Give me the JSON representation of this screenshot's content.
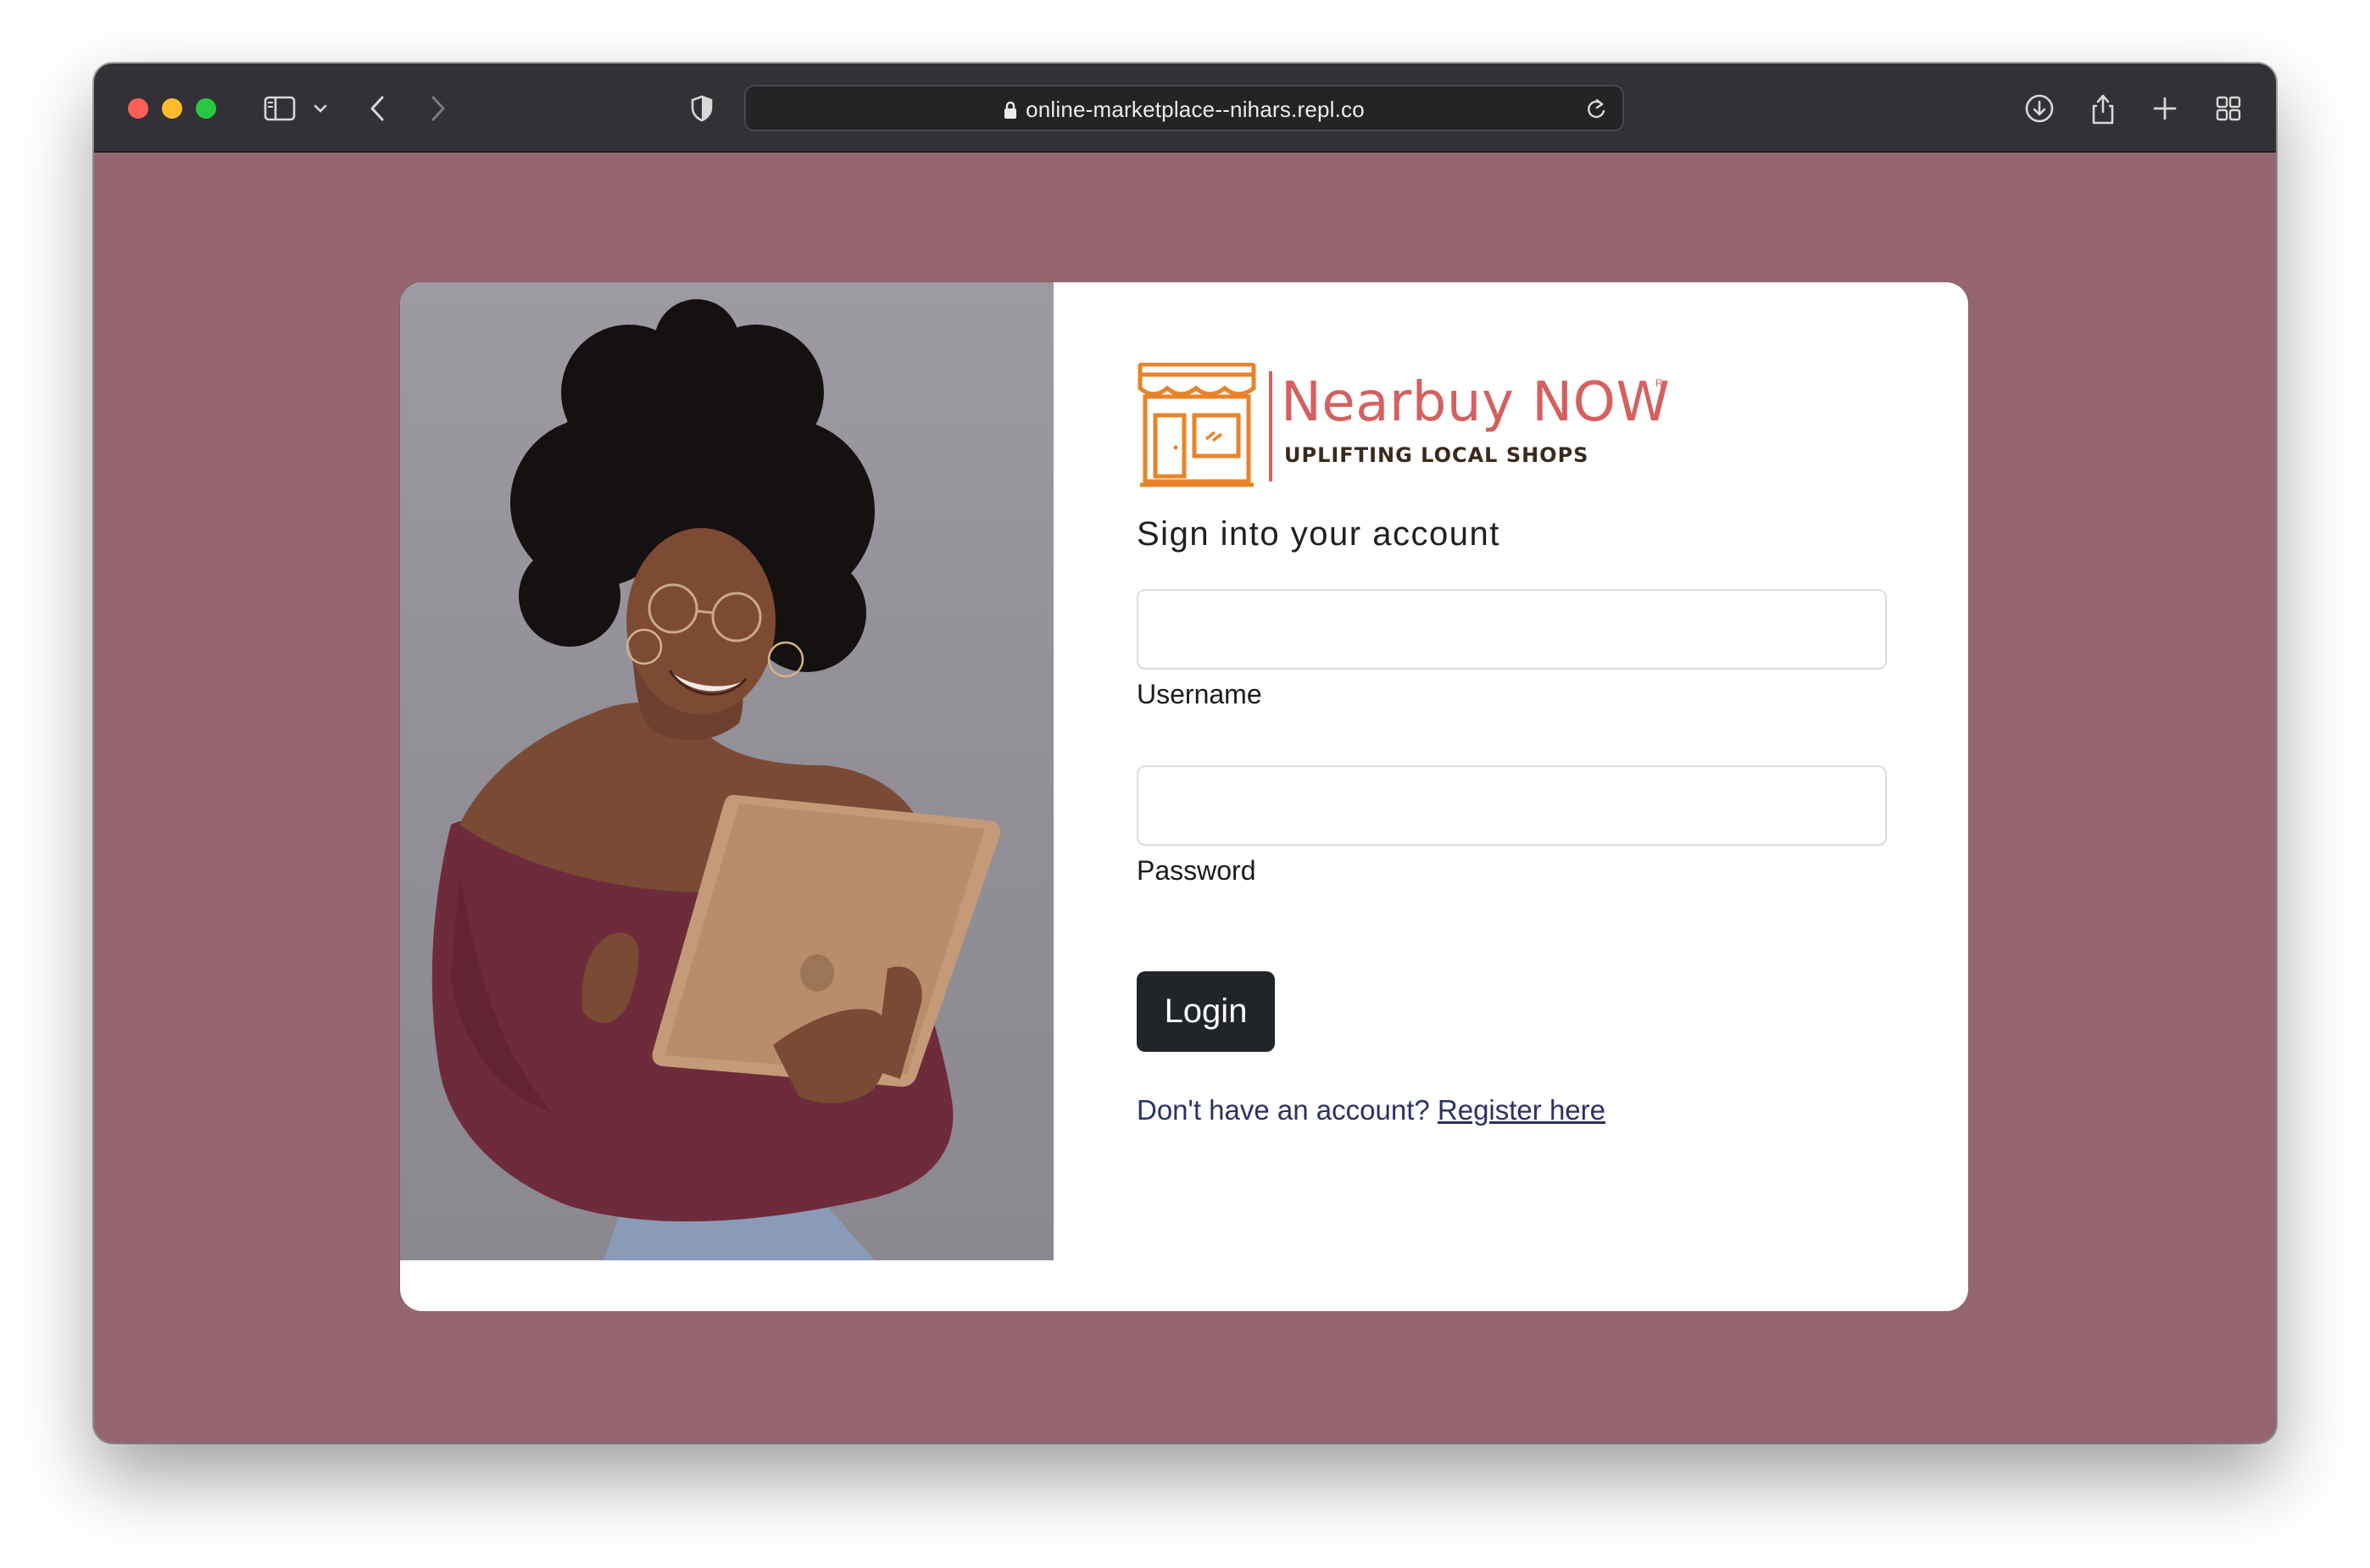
{
  "browser": {
    "url": "online-marketplace--nihars.repl.co"
  },
  "brand": {
    "name": "Nearbuy NOW",
    "registered_mark": "R",
    "tagline": "UPLIFTING LOCAL SHOPS",
    "accent_color": "#d4605f"
  },
  "form": {
    "heading": "Sign into your account",
    "username": {
      "label": "Username",
      "value": "",
      "placeholder": ""
    },
    "password": {
      "label": "Password",
      "value": "",
      "placeholder": ""
    },
    "login_label": "Login",
    "register_prompt": "Don't have an account?",
    "register_link": "Register here"
  },
  "colors": {
    "page_background": "#956570",
    "button": "#212529",
    "link": "#2b3163"
  }
}
